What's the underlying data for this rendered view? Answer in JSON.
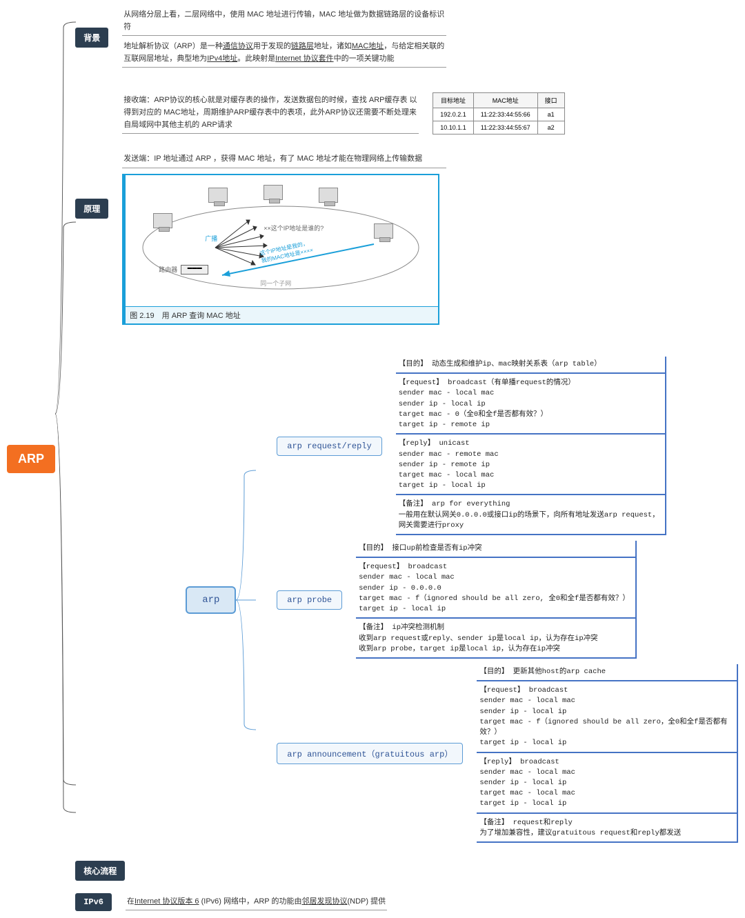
{
  "root": "ARP",
  "branches": {
    "bg": {
      "label": "背景",
      "text1": "从网络分层上看，二层网络中，使用 MAC 地址进行传输，MAC 地址做为数据链路层的设备标识符",
      "text2_pre": "地址解析协议（ARP）是一种",
      "text2_link1": "通信协议",
      "text2_mid1": "用于发现的",
      "text2_link2": "链路层",
      "text2_mid2": "地址，诸如",
      "text2_link3": "MAC地址",
      "text2_mid3": "，与给定相关联的互联网层地址，典型地为",
      "text2_link4": "IPv4地址",
      "text2_mid4": "。此映射是",
      "text2_link5": "Internet 协议套件",
      "text2_end": "中的一项关键功能"
    },
    "principle": {
      "label": "原理",
      "recv_text": "接收端：ARP协议的核心就是对缓存表的操作，发送数据包的时候，查找 ARP缓存表 以得到对应的 MAC地址，周期维护ARP缓存表中的表项，此外ARP协议还需要不断处理来自局域网中其他主机的 ARP请求",
      "send_text": "发送端：IP 地址通过 ARP ，获得 MAC 地址，有了 MAC 地址才能在物理网络上传输数据",
      "table": {
        "headers": [
          "目标地址",
          "MAC地址",
          "接口"
        ],
        "rows": [
          [
            "192.0.2.1",
            "11:22:33:44:55:66",
            "a1"
          ],
          [
            "10.10.1.1",
            "11:22:33:44:55:67",
            "a2"
          ]
        ]
      },
      "diagram": {
        "broadcast_label": "广播",
        "query_text": "××这个IP地址是谁的?",
        "reply_text1": "这个IP地址是我的，",
        "reply_text2": "我的MAC地址是××××",
        "router_label": "路由器",
        "subnet_label": "同一个子网",
        "caption": "图 2.19　用 ARP 查询 MAC 地址"
      }
    },
    "core": {
      "label": "核心流程"
    },
    "ipv6": {
      "label": "IPv6",
      "text_pre": "在",
      "text_link1": "Internet 协议版本 6",
      "text_mid1": " (IPv6) 网络中，ARP 的功能由",
      "text_link2": "邻居发现协议",
      "text_end": "(NDP) 提供"
    }
  },
  "arp_tree": {
    "root": "arp",
    "children": [
      {
        "label": "arp request/reply",
        "details": [
          "【目的】 动态生成和维护ip、mac映射关系表（arp table）",
          "【request】 broadcast（有单播request的情况）\nsender mac - local mac\nsender ip - local ip\ntarget mac - 0（全0和全f是否都有效？）\ntarget ip - remote ip",
          "【reply】 unicast\nsender mac - remote mac\nsender ip - remote ip\ntarget mac - local mac\ntarget ip - local ip",
          "【备注】 arp for everything\n一般用在默认网关0.0.0.0或接口ip的场景下，向所有地址发送arp request，\n网关需要进行proxy"
        ]
      },
      {
        "label": "arp probe",
        "details": [
          "【目的】 接口up前检查是否有ip冲突",
          "【request】 broadcast\nsender mac - local mac\nsender ip - 0.0.0.0\ntarget mac - f（ignored should be all zero, 全0和全f是否都有效？）\ntarget ip - local ip",
          "【备注】 ip冲突检测机制\n收到arp request或reply、sender ip是local ip，认为存在ip冲突\n收到arp probe，target ip是local ip，认为存在ip冲突"
        ]
      },
      {
        "label": "arp announcement（gratuitous arp）",
        "details": [
          "【目的】 更新其他host的arp cache",
          "【request】 broadcast\nsender mac - local mac\nsender ip - local ip\ntarget mac - f（ignored should be all zero，全0和全f是否都有效？）\ntarget ip - local ip",
          "【reply】 broadcast\nsender mac - local mac\nsender ip - local ip\ntarget mac - local mac\ntarget ip - local ip",
          "【备注】 request和reply\n为了增加兼容性，建议gratuitous request和reply都发送"
        ]
      }
    ]
  }
}
